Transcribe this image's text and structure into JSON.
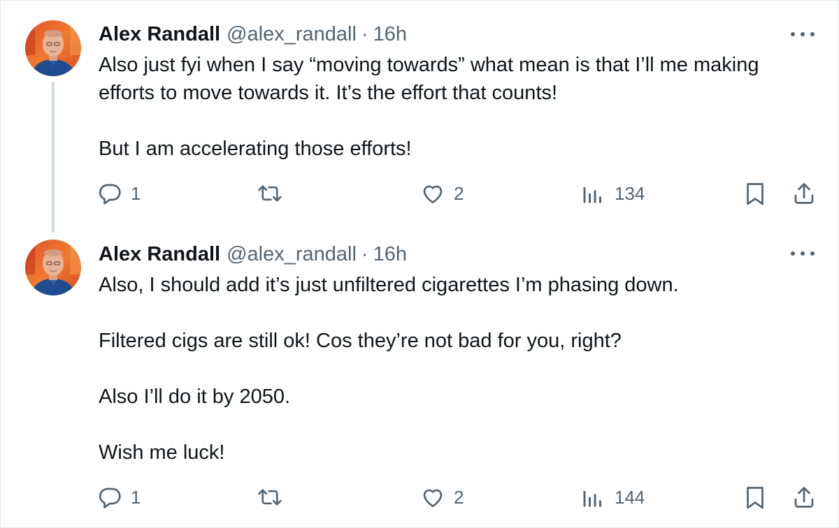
{
  "tweets": [
    {
      "author": {
        "name": "Alex Randall",
        "handle": "@alex_randall",
        "separator": "·",
        "time": "16h"
      },
      "paragraphs": [
        "Also just fyi when I say “moving towards” what mean is that I’ll me making",
        "efforts to move towards it. It’s the effort that counts!",
        "",
        "But I am accelerating those efforts!"
      ],
      "stats": {
        "replies": "1",
        "likes": "2",
        "views": "134"
      }
    },
    {
      "author": {
        "name": "Alex Randall",
        "handle": "@alex_randall",
        "separator": "·",
        "time": "16h"
      },
      "paragraphs": [
        "Also, I should add it’s just unfiltered cigarettes I’m phasing down.",
        "",
        "Filtered cigs are still ok! Cos they’re not bad for you, right?",
        "",
        "Also I’ll do it by 2050.",
        "",
        "Wish me luck!"
      ],
      "stats": {
        "replies": "1",
        "likes": "2",
        "views": "144"
      }
    }
  ],
  "colors": {
    "text": "#0f1419",
    "secondary": "#536471",
    "thread_line": "#cfd9de",
    "border": "#e6e8ea"
  },
  "icons": {
    "reply": "reply-icon",
    "retweet": "retweet-icon",
    "like": "heart-icon",
    "views": "views-chart-icon",
    "bookmark": "bookmark-icon",
    "share": "share-icon",
    "more": "more-icon"
  }
}
